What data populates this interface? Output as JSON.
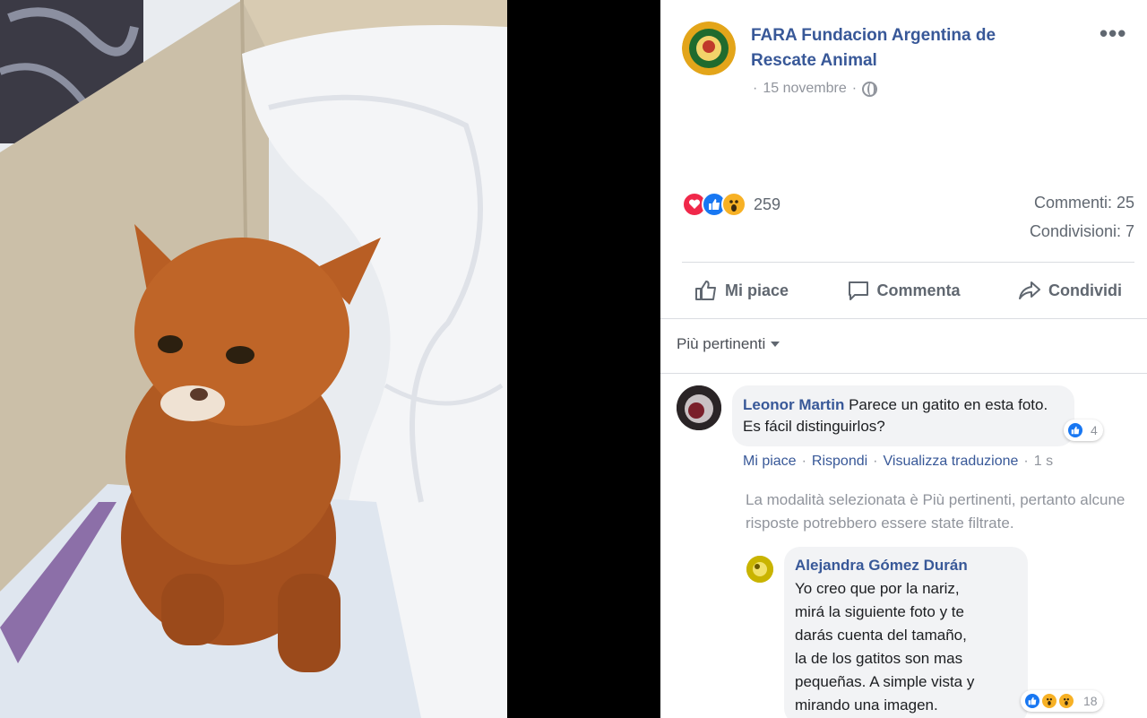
{
  "post": {
    "page_name": "FARA Fundacion Argentina de Rescate Animal",
    "date": "15 novembre",
    "date_separator": "·",
    "privacy_icon": "globe-icon",
    "more_icon": "more-options-icon",
    "more_label": "•••"
  },
  "stats": {
    "reaction_icons": [
      "love-reaction-icon",
      "like-reaction-icon",
      "wow-reaction-icon"
    ],
    "reaction_count": "259",
    "comments": "Commenti: 25",
    "shares": "Condivisioni: 7"
  },
  "actions": {
    "like": "Mi piace",
    "comment": "Commenta",
    "share": "Condividi"
  },
  "sort": {
    "label": "Più pertinenti"
  },
  "comments": [
    {
      "author": "Leonor Martin",
      "text": "Parece un gatito en esta foto. Es fácil distinguirlos?",
      "reaction_count": "4",
      "links": {
        "like": "Mi piace",
        "reply": "Rispondi",
        "translate": "Visualizza traduzione",
        "time": "1 s",
        "sep": "·"
      }
    },
    {
      "author": "Alejandra Gómez Durán",
      "lines": [
        "Yo creo que por la nariz,",
        "mirá la siguiente foto y te",
        "darás cuenta del tamaño,",
        "la de los gatitos son mas",
        "pequeñas. A simple vista y",
        "mirando una imagen."
      ],
      "reaction_count": "18"
    }
  ],
  "filter_note": "La modalità selezionata è Più pertinenti, pertanto alcune risposte potrebbero essere state filtrate.",
  "colors": {
    "link_blue": "#385898",
    "muted": "#90949c",
    "love": "#f0284a",
    "like": "#1877f2",
    "wow": "#f7b125"
  }
}
